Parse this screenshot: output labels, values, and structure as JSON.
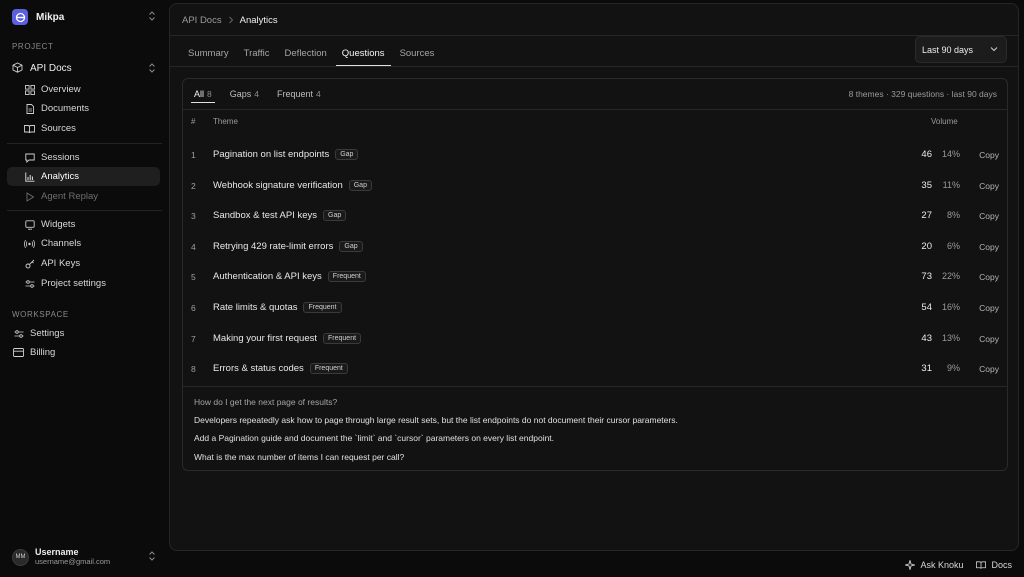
{
  "workspace_name": "Mikpa",
  "sidebar": {
    "project_label": "PROJECT",
    "project_name": "API Docs",
    "group1": [
      {
        "label": "Overview",
        "icon": "grid-icon"
      },
      {
        "label": "Documents",
        "icon": "file-icon"
      },
      {
        "label": "Sources",
        "icon": "book-icon"
      }
    ],
    "group2": [
      {
        "label": "Sessions",
        "icon": "chat-icon"
      },
      {
        "label": "Analytics",
        "icon": "bar-chart-icon",
        "active": true
      },
      {
        "label": "Agent Replay",
        "icon": "play-icon",
        "muted": true
      }
    ],
    "group3": [
      {
        "label": "Widgets",
        "icon": "widget-icon"
      },
      {
        "label": "Channels",
        "icon": "broadcast-icon"
      },
      {
        "label": "API Keys",
        "icon": "key-icon"
      },
      {
        "label": "Project settings",
        "icon": "sliders-icon"
      }
    ],
    "workspace_label": "WORKSPACE",
    "workspace_items": [
      {
        "label": "Settings",
        "icon": "settings-sliders-icon"
      },
      {
        "label": "Billing",
        "icon": "card-icon"
      }
    ],
    "user": {
      "initials": "MM",
      "name": "Username",
      "email": "username@gmail.com"
    }
  },
  "breadcrumb": {
    "parent": "API Docs",
    "current": "Analytics"
  },
  "tabs": [
    "Summary",
    "Traffic",
    "Deflection",
    "Questions",
    "Sources"
  ],
  "active_tab": "Questions",
  "date_range": "Last 90 days",
  "card": {
    "subtabs": [
      {
        "label": "All",
        "count": "8"
      },
      {
        "label": "Gaps",
        "count": "4"
      },
      {
        "label": "Frequent",
        "count": "4"
      }
    ],
    "summary": "8 themes · 329 questions · last 90 days",
    "headers": {
      "num": "#",
      "theme": "Theme",
      "volume": "Volume"
    },
    "rows": [
      {
        "num": "1",
        "theme": "Pagination on list endpoints",
        "badge": "Gap",
        "count": "46",
        "pct": "14%",
        "action": "Copy"
      },
      {
        "num": "2",
        "theme": "Webhook signature verification",
        "badge": "Gap",
        "count": "35",
        "pct": "11%",
        "action": "Copy"
      },
      {
        "num": "3",
        "theme": "Sandbox & test API keys",
        "badge": "Gap",
        "count": "27",
        "pct": "8%",
        "action": "Copy"
      },
      {
        "num": "4",
        "theme": "Retrying 429 rate-limit errors",
        "badge": "Gap",
        "count": "20",
        "pct": "6%",
        "action": "Copy"
      },
      {
        "num": "5",
        "theme": "Authentication & API keys",
        "badge": "Frequent",
        "count": "73",
        "pct": "22%",
        "action": "Copy"
      },
      {
        "num": "6",
        "theme": "Rate limits & quotas",
        "badge": "Frequent",
        "count": "54",
        "pct": "16%",
        "action": "Copy"
      },
      {
        "num": "7",
        "theme": "Making your first request",
        "badge": "Frequent",
        "count": "43",
        "pct": "13%",
        "action": "Copy"
      },
      {
        "num": "8",
        "theme": "Errors & status codes",
        "badge": "Frequent",
        "count": "31",
        "pct": "9%",
        "action": "Copy"
      }
    ],
    "detail": {
      "question": "How do I get the next page of results?",
      "insight": "Developers repeatedly ask how to page through large result sets, but the list endpoints do not document their cursor parameters.",
      "recommendation": "Add a Pagination guide and document the `limit` and `cursor` parameters on every list endpoint.",
      "related_question": "What is the max number of items I can request per call?"
    }
  },
  "footer": {
    "ask": "Ask Knoku",
    "docs": "Docs"
  },
  "colors": {
    "accent": "#5b5fe0",
    "background": "#0b0b0b",
    "panel": "#121212"
  }
}
